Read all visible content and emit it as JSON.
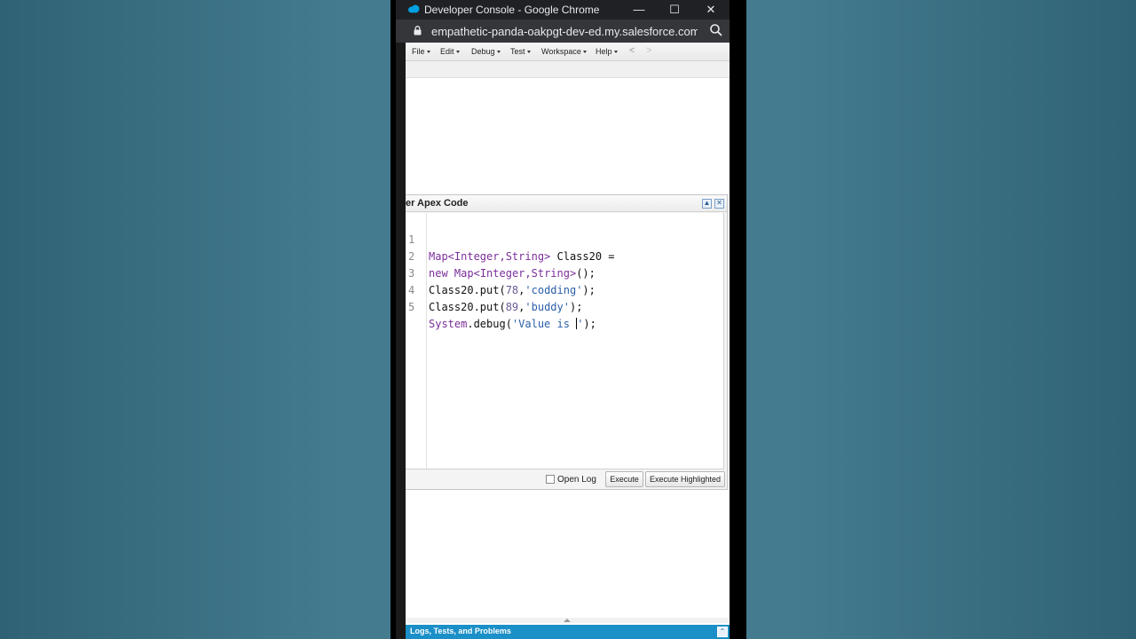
{
  "window": {
    "title": "Developer Console - Google Chrome",
    "minimize_symbol": "—",
    "maximize_symbol": "☐",
    "close_symbol": "✕"
  },
  "address_bar": {
    "url": "empathetic-panda-oakpgt-dev-ed.my.salesforce.com...",
    "lock_icon": "lock-icon",
    "zoom_icon": "magnifier-icon"
  },
  "menubar": {
    "items": [
      {
        "label": "File"
      },
      {
        "label": "Edit"
      },
      {
        "label": "Debug"
      },
      {
        "label": "Test"
      },
      {
        "label": "Workspace"
      },
      {
        "label": "Help"
      }
    ],
    "back_symbol": "<",
    "forward_symbol": ">"
  },
  "dialog": {
    "title": "er Apex Code",
    "maximize_symbol": "▲",
    "close_symbol": "✕",
    "lines": [
      {
        "n": "1"
      },
      {
        "n": "2"
      },
      {
        "n": "3"
      },
      {
        "n": "4"
      },
      {
        "n": "5"
      }
    ],
    "code_tokens": {
      "l1_a": "Map<Integer,String>",
      "l1_b": " Class20 =",
      "l2_a": "new",
      "l2_b": " ",
      "l2_c": "Map<Integer,String>",
      "l2_d": "();",
      "l3_a": "Class20.put(",
      "l3_b": "78",
      "l3_c": ",",
      "l3_d": "'codding'",
      "l3_e": ");",
      "l4_a": "Class20.put(",
      "l4_b": "89",
      "l4_c": ",",
      "l4_d": "'buddy'",
      "l4_e": ");",
      "l5_a": "System",
      "l5_b": ".debug(",
      "l5_c": "'Value is ",
      "l5_d": "'",
      "l5_e": ");"
    },
    "footer": {
      "open_log_label": "Open Log",
      "open_log_checked": false,
      "execute_label": "Execute",
      "execute_highlighted_label": "Execute Highlighted"
    }
  },
  "bottom_panel": {
    "label": "Logs, Tests, and Problems",
    "expand_symbol": "⌃"
  },
  "colors": {
    "background": "#447b8f",
    "chrome_dark": "#202124",
    "panel_bar": "#1b8fc7",
    "keyword": "#7a2f9a",
    "string": "#2c5fa8"
  }
}
